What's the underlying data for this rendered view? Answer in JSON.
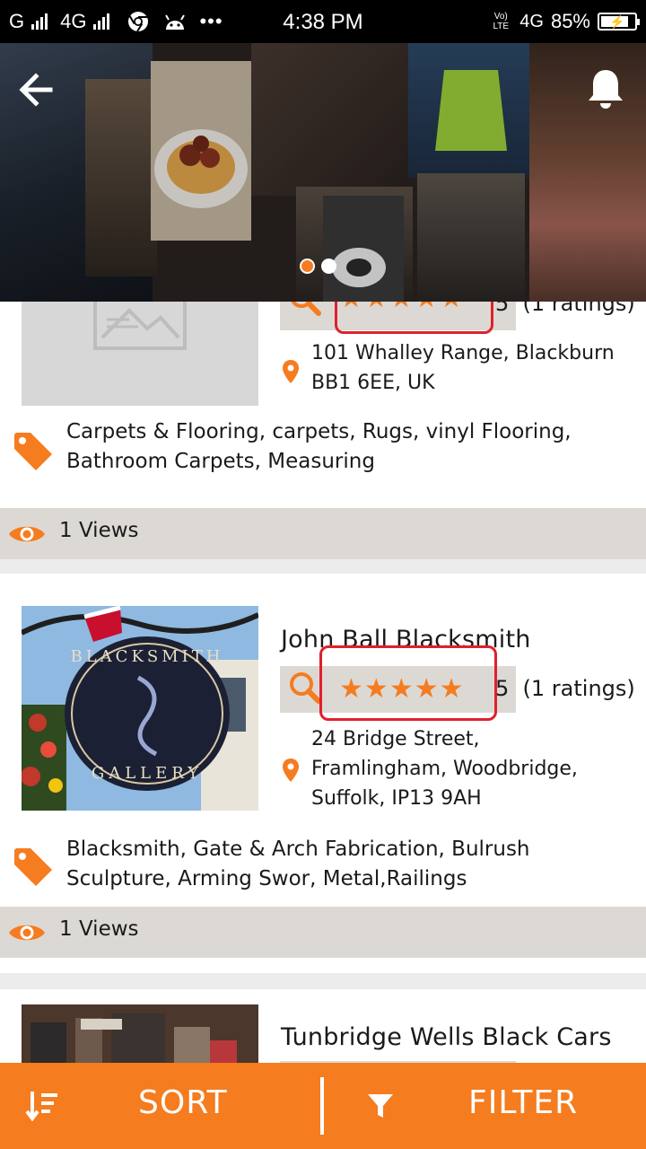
{
  "status_bar": {
    "carrier_left": "G",
    "network_left": "4G",
    "time": "4:38 PM",
    "volte": "Vo) LTE",
    "network_right": "4G",
    "battery": "85%",
    "icons": [
      "signal-icon",
      "chrome-icon",
      "android-icon",
      "more-icon",
      "battery-icon"
    ]
  },
  "header": {
    "back_icon": "back-arrow-icon",
    "notification_icon": "bell-icon",
    "carousel_pages": 2,
    "carousel_active": 0
  },
  "listings": [
    {
      "title": "",
      "rating_stars": 5,
      "rating_value": "5",
      "rating_count": "(1 ratings)",
      "address": "101 Whalley Range, Blackburn BB1 6EE, UK",
      "categories": "Carpets & Flooring, carpets, Rugs, vinyl Flooring, Bathroom Carpets, Measuring",
      "views": "1 Views",
      "image": "placeholder-image-icon"
    },
    {
      "title": "John Ball Blacksmith",
      "rating_stars": 5,
      "rating_value": "5",
      "rating_count": "(1 ratings)",
      "address": "24 Bridge Street, Framlingham, Woodbridge, Suffolk, IP13 9AH",
      "categories": "Blacksmith, Gate & Arch Fabrication, Bulrush Sculpture, Arming Swor, Metal,Railings",
      "views": "1 Views",
      "image": "blacksmith-gallery-sign",
      "image_sign_top": "BLACKSMITH",
      "image_sign_bottom": "GALLERY"
    },
    {
      "title": "Tunbridge Wells Black Cars",
      "image": "street-photo"
    }
  ],
  "bottom_bar": {
    "sort_label": "SORT",
    "filter_label": "FILTER"
  },
  "colors": {
    "accent": "#f57c1f",
    "highlight": "#e0202c",
    "rating_bg": "#dcd9d5",
    "page_bg": "#ececec"
  }
}
